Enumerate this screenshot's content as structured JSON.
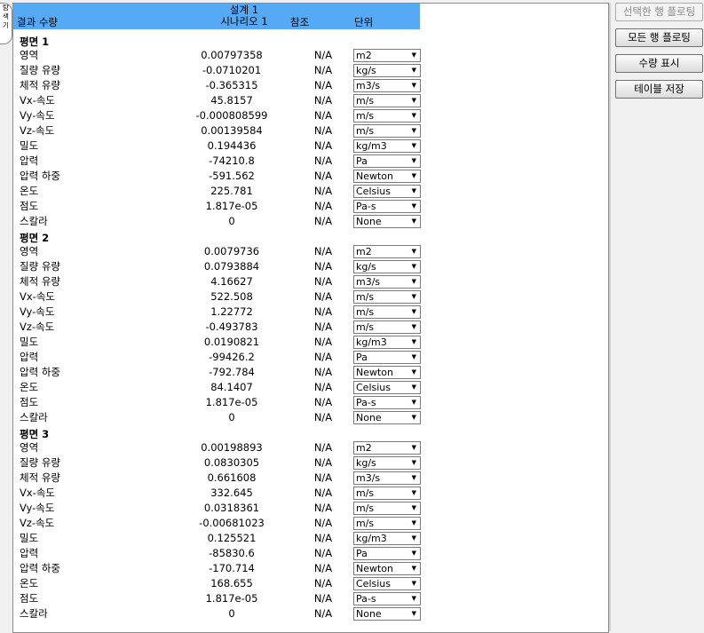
{
  "side_tab": [
    "탐",
    "색",
    "기"
  ],
  "header": {
    "quantity_col": "결과 수량",
    "design_label": "설계 1",
    "scenario_label": "시나리오 1",
    "reference_col": "참조",
    "unit_col": "단위"
  },
  "buttons": {
    "plot_selected": "선택한 행 플로팅",
    "plot_all": "모든 행 플로팅",
    "show_quantity": "수량 표시",
    "save_table": "테이블 저장"
  },
  "groups": [
    {
      "title": "평면 1",
      "rows": [
        {
          "name": "영역",
          "value": "0.00797358",
          "ref": "N/A",
          "unit": "m2"
        },
        {
          "name": "질량 유량",
          "value": "-0.0710201",
          "ref": "N/A",
          "unit": "kg/s"
        },
        {
          "name": "체적 유량",
          "value": "-0.365315",
          "ref": "N/A",
          "unit": "m3/s"
        },
        {
          "name": "Vx-속도",
          "value": "45.8157",
          "ref": "N/A",
          "unit": "m/s"
        },
        {
          "name": "Vy-속도",
          "value": "-0.000808599",
          "ref": "N/A",
          "unit": "m/s"
        },
        {
          "name": "Vz-속도",
          "value": "0.00139584",
          "ref": "N/A",
          "unit": "m/s"
        },
        {
          "name": "밀도",
          "value": "0.194436",
          "ref": "N/A",
          "unit": "kg/m3"
        },
        {
          "name": "압력",
          "value": "-74210.8",
          "ref": "N/A",
          "unit": "Pa"
        },
        {
          "name": "압력 하중",
          "value": "-591.562",
          "ref": "N/A",
          "unit": "Newton"
        },
        {
          "name": "온도",
          "value": "225.781",
          "ref": "N/A",
          "unit": "Celsius"
        },
        {
          "name": "점도",
          "value": "1.817e-05",
          "ref": "N/A",
          "unit": "Pa-s"
        },
        {
          "name": "스칼라",
          "value": "0",
          "ref": "N/A",
          "unit": "None"
        }
      ]
    },
    {
      "title": "평면 2",
      "rows": [
        {
          "name": "영역",
          "value": "0.0079736",
          "ref": "N/A",
          "unit": "m2"
        },
        {
          "name": "질량 유량",
          "value": "0.0793884",
          "ref": "N/A",
          "unit": "kg/s"
        },
        {
          "name": "체적 유량",
          "value": "4.16627",
          "ref": "N/A",
          "unit": "m3/s"
        },
        {
          "name": "Vx-속도",
          "value": "522.508",
          "ref": "N/A",
          "unit": "m/s"
        },
        {
          "name": "Vy-속도",
          "value": "1.22772",
          "ref": "N/A",
          "unit": "m/s"
        },
        {
          "name": "Vz-속도",
          "value": "-0.493783",
          "ref": "N/A",
          "unit": "m/s"
        },
        {
          "name": "밀도",
          "value": "0.0190821",
          "ref": "N/A",
          "unit": "kg/m3"
        },
        {
          "name": "압력",
          "value": "-99426.2",
          "ref": "N/A",
          "unit": "Pa"
        },
        {
          "name": "압력 하중",
          "value": "-792.784",
          "ref": "N/A",
          "unit": "Newton"
        },
        {
          "name": "온도",
          "value": "84.1407",
          "ref": "N/A",
          "unit": "Celsius"
        },
        {
          "name": "점도",
          "value": "1.817e-05",
          "ref": "N/A",
          "unit": "Pa-s"
        },
        {
          "name": "스칼라",
          "value": "0",
          "ref": "N/A",
          "unit": "None"
        }
      ]
    },
    {
      "title": "평면 3",
      "rows": [
        {
          "name": "영역",
          "value": "0.00198893",
          "ref": "N/A",
          "unit": "m2"
        },
        {
          "name": "질량 유량",
          "value": "0.0830305",
          "ref": "N/A",
          "unit": "kg/s"
        },
        {
          "name": "체적 유량",
          "value": "0.661608",
          "ref": "N/A",
          "unit": "m3/s"
        },
        {
          "name": "Vx-속도",
          "value": "332.645",
          "ref": "N/A",
          "unit": "m/s"
        },
        {
          "name": "Vy-속도",
          "value": "0.0318361",
          "ref": "N/A",
          "unit": "m/s"
        },
        {
          "name": "Vz-속도",
          "value": "-0.00681023",
          "ref": "N/A",
          "unit": "m/s"
        },
        {
          "name": "밀도",
          "value": "0.125521",
          "ref": "N/A",
          "unit": "kg/m3"
        },
        {
          "name": "압력",
          "value": "-85830.6",
          "ref": "N/A",
          "unit": "Pa"
        },
        {
          "name": "압력 하중",
          "value": "-170.714",
          "ref": "N/A",
          "unit": "Newton"
        },
        {
          "name": "온도",
          "value": "168.655",
          "ref": "N/A",
          "unit": "Celsius"
        },
        {
          "name": "점도",
          "value": "1.817e-05",
          "ref": "N/A",
          "unit": "Pa-s"
        },
        {
          "name": "스칼라",
          "value": "0",
          "ref": "N/A",
          "unit": "None"
        }
      ]
    }
  ]
}
